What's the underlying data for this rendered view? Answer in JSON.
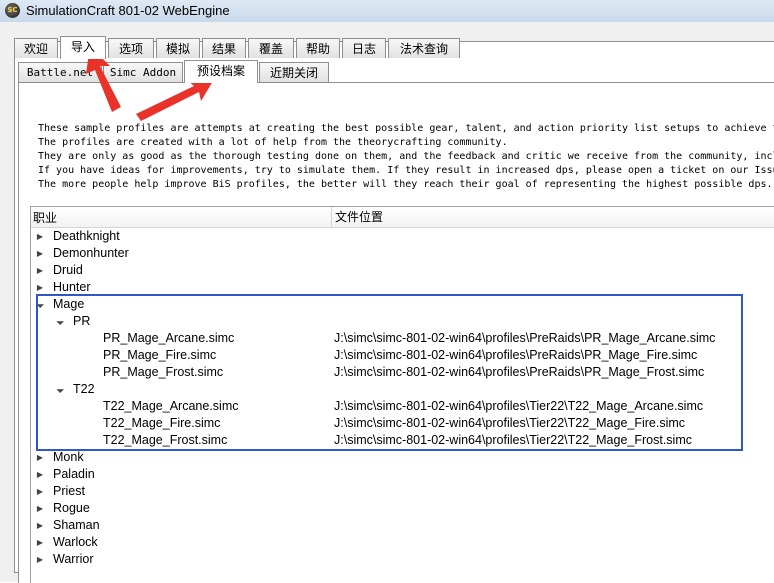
{
  "window": {
    "title": "SimulationCraft 801-02 WebEngine",
    "icon_text": "SC"
  },
  "main_tabs": [
    "欢迎",
    "导入",
    "选项",
    "模拟",
    "结果",
    "覆盖",
    "帮助",
    "日志",
    "法术查询"
  ],
  "active_main_tab": "导入",
  "sub_tabs": [
    "Battle.net",
    "Simc Addon",
    "预设档案",
    "近期关闭"
  ],
  "active_sub_tab": "预设档案",
  "description_lines": [
    "These sample profiles are attempts at creating the best possible gear, talent, and action priority list setups to achieve t",
    "The profiles are created with a lot of help from the theorycrafting community.",
    "They are only as good as the thorough testing done on them, and the feedback and critic we receive from the community, incl",
    "If you have ideas for improvements, try to simulate them. If they result in increased dps, please open a ticket on our Issu",
    "The more people help improve BiS profiles, the better will they reach their goal of representing the highest possible dps."
  ],
  "tree": {
    "columns": [
      "职业",
      "文件位置"
    ],
    "rows": [
      {
        "label": "Deathknight",
        "level": 0,
        "expanded": false,
        "path": ""
      },
      {
        "label": "Demonhunter",
        "level": 0,
        "expanded": false,
        "path": ""
      },
      {
        "label": "Druid",
        "level": 0,
        "expanded": false,
        "path": ""
      },
      {
        "label": "Hunter",
        "level": 0,
        "expanded": false,
        "path": ""
      },
      {
        "label": "Mage",
        "level": 0,
        "expanded": true,
        "path": ""
      },
      {
        "label": "PR",
        "level": 1,
        "expanded": true,
        "path": ""
      },
      {
        "label": "PR_Mage_Arcane.simc",
        "level": 2,
        "leaf": true,
        "path": "J:\\simc\\simc-801-02-win64\\profiles\\PreRaids\\PR_Mage_Arcane.simc"
      },
      {
        "label": "PR_Mage_Fire.simc",
        "level": 2,
        "leaf": true,
        "path": "J:\\simc\\simc-801-02-win64\\profiles\\PreRaids\\PR_Mage_Fire.simc"
      },
      {
        "label": "PR_Mage_Frost.simc",
        "level": 2,
        "leaf": true,
        "path": "J:\\simc\\simc-801-02-win64\\profiles\\PreRaids\\PR_Mage_Frost.simc"
      },
      {
        "label": "T22",
        "level": 1,
        "expanded": true,
        "path": ""
      },
      {
        "label": "T22_Mage_Arcane.simc",
        "level": 2,
        "leaf": true,
        "path": "J:\\simc\\simc-801-02-win64\\profiles\\Tier22\\T22_Mage_Arcane.simc"
      },
      {
        "label": "T22_Mage_Fire.simc",
        "level": 2,
        "leaf": true,
        "path": "J:\\simc\\simc-801-02-win64\\profiles\\Tier22\\T22_Mage_Fire.simc"
      },
      {
        "label": "T22_Mage_Frost.simc",
        "level": 2,
        "leaf": true,
        "path": "J:\\simc\\simc-801-02-win64\\profiles\\Tier22\\T22_Mage_Frost.simc"
      },
      {
        "label": "Monk",
        "level": 0,
        "expanded": false,
        "path": ""
      },
      {
        "label": "Paladin",
        "level": 0,
        "expanded": false,
        "path": ""
      },
      {
        "label": "Priest",
        "level": 0,
        "expanded": false,
        "path": ""
      },
      {
        "label": "Rogue",
        "level": 0,
        "expanded": false,
        "path": ""
      },
      {
        "label": "Shaman",
        "level": 0,
        "expanded": false,
        "path": ""
      },
      {
        "label": "Warlock",
        "level": 0,
        "expanded": false,
        "path": ""
      },
      {
        "label": "Warrior",
        "level": 0,
        "expanded": false,
        "path": ""
      }
    ]
  },
  "colors": {
    "annotation_arrow": "#e8322a",
    "highlight_box": "#2f57c9"
  }
}
